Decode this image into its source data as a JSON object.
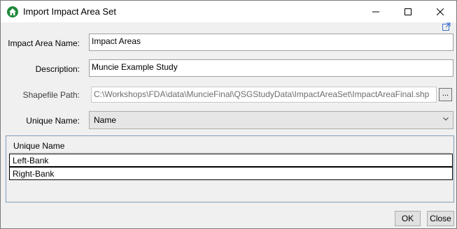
{
  "window": {
    "title": "Import Impact Area Set",
    "icon": "home-icon",
    "controls": [
      "minimize-icon",
      "maximize-icon",
      "close-icon"
    ]
  },
  "form": {
    "impact_area_name_label": "Impact Area Name:",
    "impact_area_name_value": "Impact Areas",
    "description_label": "Description:",
    "description_value": "Muncie Example Study",
    "shapefile_path_label": "Shapefile Path:",
    "shapefile_path_value": "C:\\Workshops\\FDA\\data\\MuncieFinal\\QSGStudyData\\ImpactAreaSet\\ImpactAreaFinal.shp",
    "browse_label": "...",
    "unique_name_label": "Unique Name:",
    "unique_name_selected": "Name"
  },
  "grid": {
    "header": "Unique Name",
    "rows": [
      "Left-Bank",
      "Right-Bank"
    ]
  },
  "footer": {
    "ok_label": "OK",
    "close_label": "Close"
  },
  "colors": {
    "title_icon_bg": "#1f8a3a",
    "dialog_bg": "#f0f0f0",
    "grid_border": "#7f9db9"
  }
}
